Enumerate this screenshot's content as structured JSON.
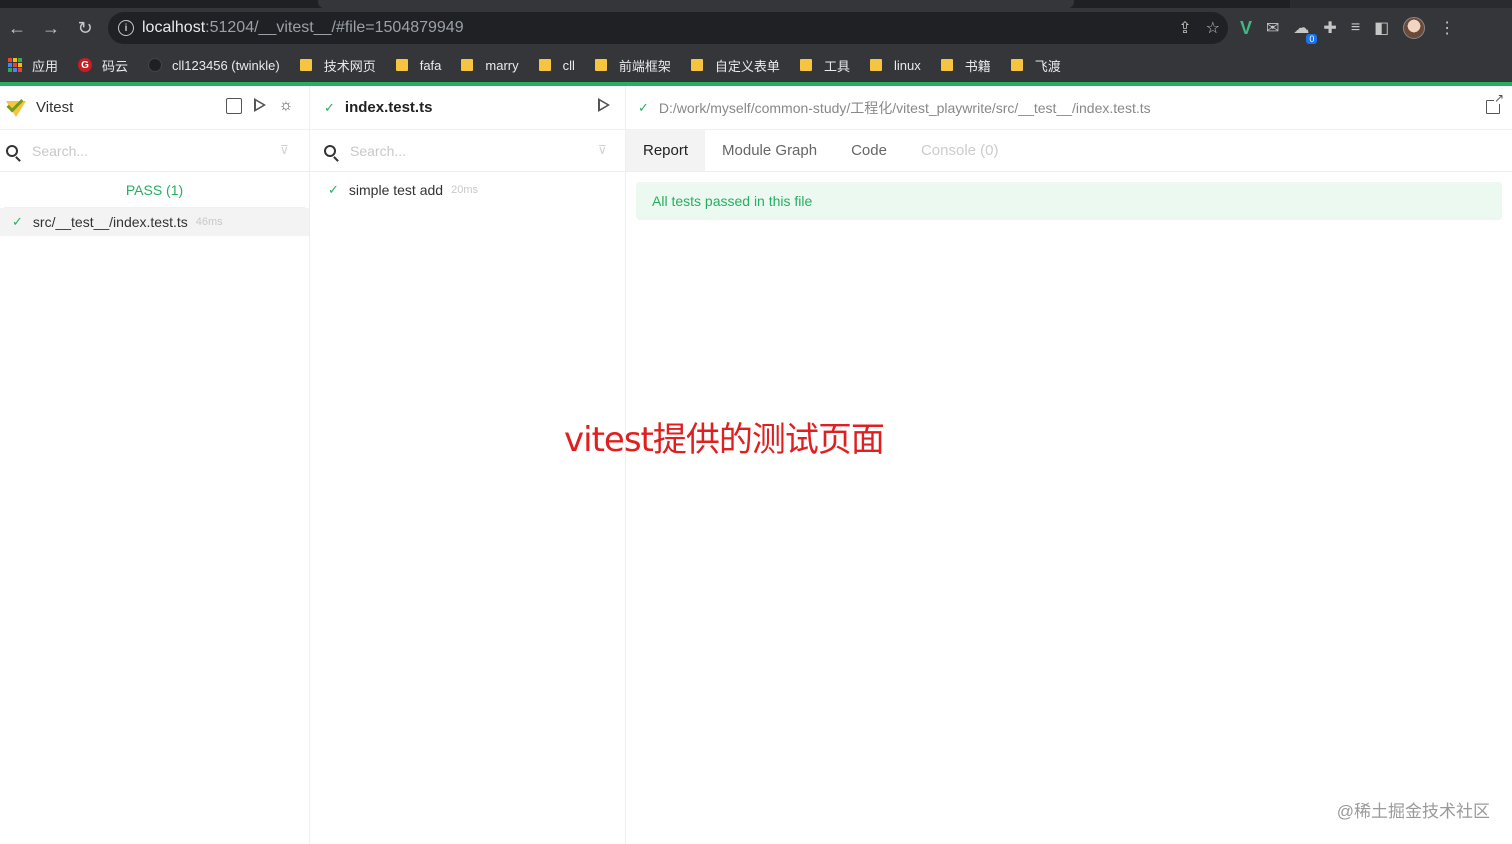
{
  "browser": {
    "url_host": "localhost",
    "url_rest": ":51204/__vitest__/#file=1504879949",
    "ext_badge_count": "0",
    "bookmarks": [
      {
        "label": "应用",
        "icon": "apps-grid-icon"
      },
      {
        "label": "码云",
        "icon": "gitee-icon"
      },
      {
        "label": "cll123456 (twinkle)",
        "icon": "github-icon"
      },
      {
        "label": "技术网页",
        "icon": "folder-icon"
      },
      {
        "label": "fafa",
        "icon": "folder-icon"
      },
      {
        "label": "marry",
        "icon": "folder-icon"
      },
      {
        "label": "cll",
        "icon": "folder-icon"
      },
      {
        "label": "前端框架",
        "icon": "folder-icon"
      },
      {
        "label": "自定义表单",
        "icon": "folder-icon"
      },
      {
        "label": "工具",
        "icon": "folder-icon"
      },
      {
        "label": "linux",
        "icon": "folder-icon"
      },
      {
        "label": "书籍",
        "icon": "folder-icon"
      },
      {
        "label": "飞渡",
        "icon": "folder-icon"
      }
    ]
  },
  "sidebar": {
    "title": "Vitest",
    "search_placeholder": "Search...",
    "pass_label": "PASS (1)",
    "files": [
      {
        "name": "src/__test__/index.test.ts",
        "duration": "46ms"
      }
    ]
  },
  "middle": {
    "title": "index.test.ts",
    "search_placeholder": "Search...",
    "tests": [
      {
        "name": "simple test add",
        "duration": "20ms"
      }
    ]
  },
  "detail": {
    "path": "D:/work/myself/common-study/工程化/vitest_playwrite/src/__test__/index.test.ts",
    "tabs": [
      {
        "label": "Report",
        "state": "active"
      },
      {
        "label": "Module Graph",
        "state": "normal"
      },
      {
        "label": "Code",
        "state": "normal"
      },
      {
        "label": "Console (0)",
        "state": "disabled"
      }
    ],
    "banner": "All tests passed in this file"
  },
  "overlay": {
    "caption": "vitest提供的测试页面",
    "watermark": "@稀土掘金技术社区"
  },
  "colors": {
    "pass_green": "#27ae60",
    "caption_red": "#e02020",
    "chrome_dark": "#35363a"
  }
}
